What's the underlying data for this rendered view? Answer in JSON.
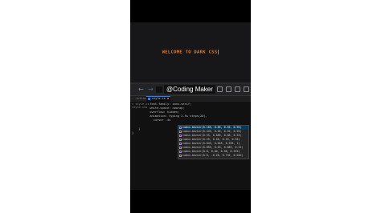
{
  "preview": {
    "heading": "WELCOME TO DARK CSS"
  },
  "toolbar": {
    "back": "←",
    "forward": "→",
    "channel_tag": "@Coding Maker"
  },
  "tabs": {
    "explorer": "...iction",
    "active_label": "style.cs"
  },
  "editor": {
    "tree_row": "> style.cs",
    "sidebar_row": "style.css",
    "lines": [
      "  font-family: sans-serif;",
      "  white-space: nowrap;",
      "  overflow: hidden;",
      "  animation: typing 2.5s steps(20),",
      "    cursor .4s",
      "  }",
      "}"
    ],
    "suggestions": [
      "cubic-bezier(0.165, 0.85, 0.55, 0.95)",
      "cubic-bezier(0.445, 0.05, 0.55, 0.95)",
      "cubic-bezier(0.55, 0.085, 0.68, 0.53)",
      "cubic-bezier(0.25, 0.46, 0.45, 0.94)",
      "cubic-bezier(0.645, 0.045, 0.355, 1)",
      "cubic-bezier(0.895, 0.03, 0.685, 0.22)",
      "cubic-bezier(0.6, 0.04, 0.98, 0.335)",
      "cubic-bezier(0.6, -0.28, 0.735, 0.045)"
    ]
  },
  "colors": {
    "accent": "#e07a2f",
    "selection": "#04395e"
  }
}
